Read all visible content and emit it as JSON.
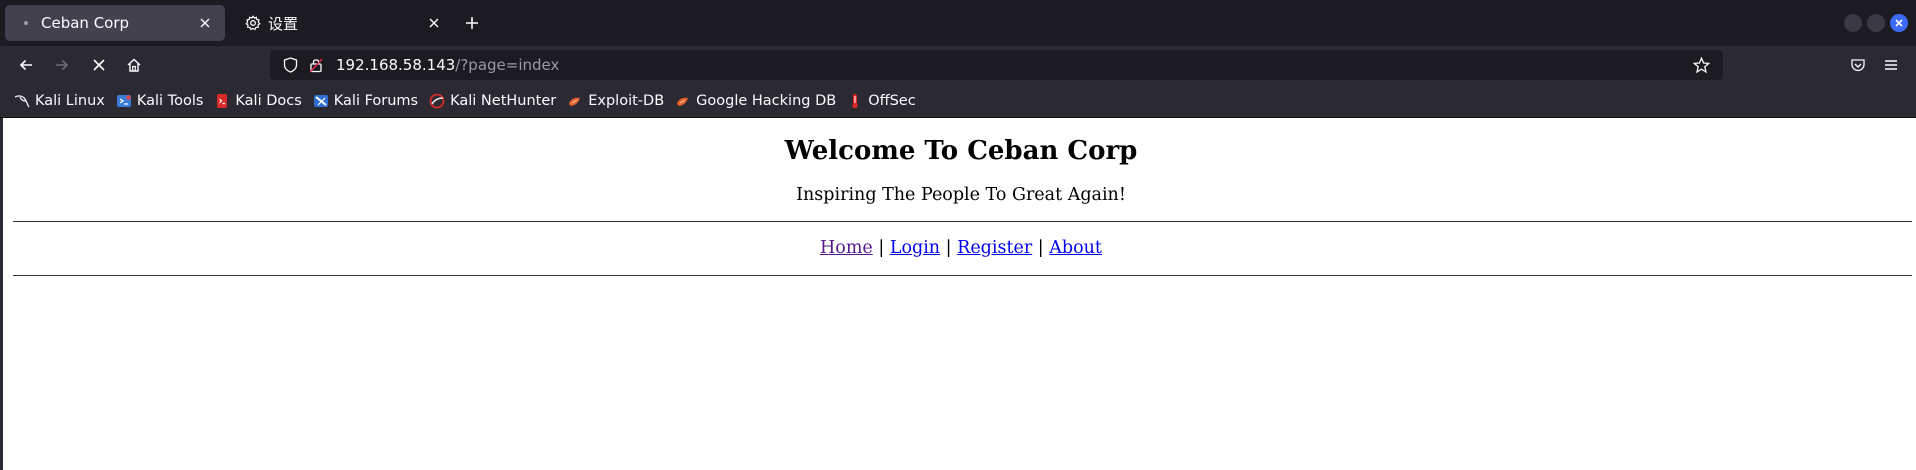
{
  "browser": {
    "tabs": [
      {
        "title": "Ceban Corp",
        "active": true,
        "icon": "dot-icon"
      },
      {
        "title": "设置",
        "active": false,
        "icon": "gear-icon"
      }
    ],
    "url": {
      "host": "192.168.58.143",
      "path": "/?page=index"
    },
    "bookmarks": [
      {
        "label": "Kali Linux",
        "icon": "kali-dragon-icon"
      },
      {
        "label": "Kali Tools",
        "icon": "kali-tools-icon"
      },
      {
        "label": "Kali Docs",
        "icon": "kali-docs-icon"
      },
      {
        "label": "Kali Forums",
        "icon": "kali-forums-icon"
      },
      {
        "label": "Kali NetHunter",
        "icon": "nethunter-icon"
      },
      {
        "label": "Exploit-DB",
        "icon": "exploitdb-icon"
      },
      {
        "label": "Google Hacking DB",
        "icon": "ghdb-icon"
      },
      {
        "label": "OffSec",
        "icon": "offsec-icon"
      }
    ],
    "colors": {
      "chrome_dark": "#1c1b22",
      "chrome": "#2b2a33",
      "active_tab": "#42414d",
      "accent": "#3d6af5"
    }
  },
  "page": {
    "heading": "Welcome To Ceban Corp",
    "tagline": "Inspiring The People To Great Again!",
    "nav": [
      {
        "label": "Home",
        "visited": true
      },
      {
        "label": "Login",
        "visited": false
      },
      {
        "label": "Register",
        "visited": false
      },
      {
        "label": "About",
        "visited": false
      }
    ],
    "separator": "|",
    "link_colors": {
      "link": "#0000ee",
      "visited": "#551a8b"
    }
  }
}
